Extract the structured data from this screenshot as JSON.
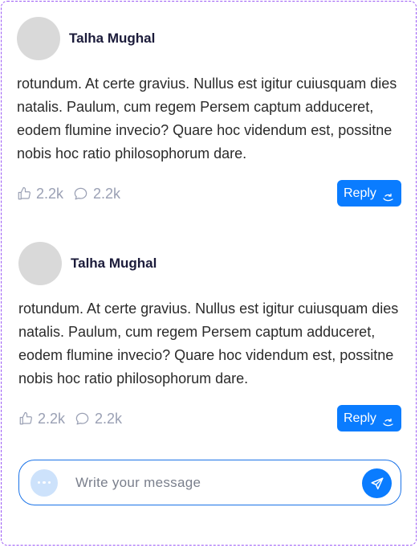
{
  "comments": [
    {
      "author": "Talha Mughal",
      "text": "rotundum. At certe gravius. Nullus est igitur cuiusquam dies natalis. Paulum, cum regem Persem captum adduceret, eodem flumine invecio? Quare hoc videndum est, possitne nobis hoc ratio philosophorum dare.",
      "likes": "2.2k",
      "replies": "2.2k",
      "reply_label": "Reply"
    },
    {
      "author": "Talha Mughal",
      "text": "rotundum. At certe gravius. Nullus est igitur cuiusquam dies natalis. Paulum, cum regem Persem captum adduceret, eodem flumine invecio? Quare hoc videndum est, possitne nobis hoc ratio philosophorum dare.",
      "likes": "2.2k",
      "replies": "2.2k",
      "reply_label": "Reply"
    }
  ],
  "composer": {
    "placeholder": "Write your message"
  },
  "colors": {
    "accent": "#0a7cff",
    "border_dashed": "#9b59f5",
    "muted": "#9aa0b4"
  },
  "icons": [
    "thumbs-up-icon",
    "comment-bubble-icon",
    "reply-arrow-icon",
    "more-dots-icon",
    "send-icon"
  ]
}
